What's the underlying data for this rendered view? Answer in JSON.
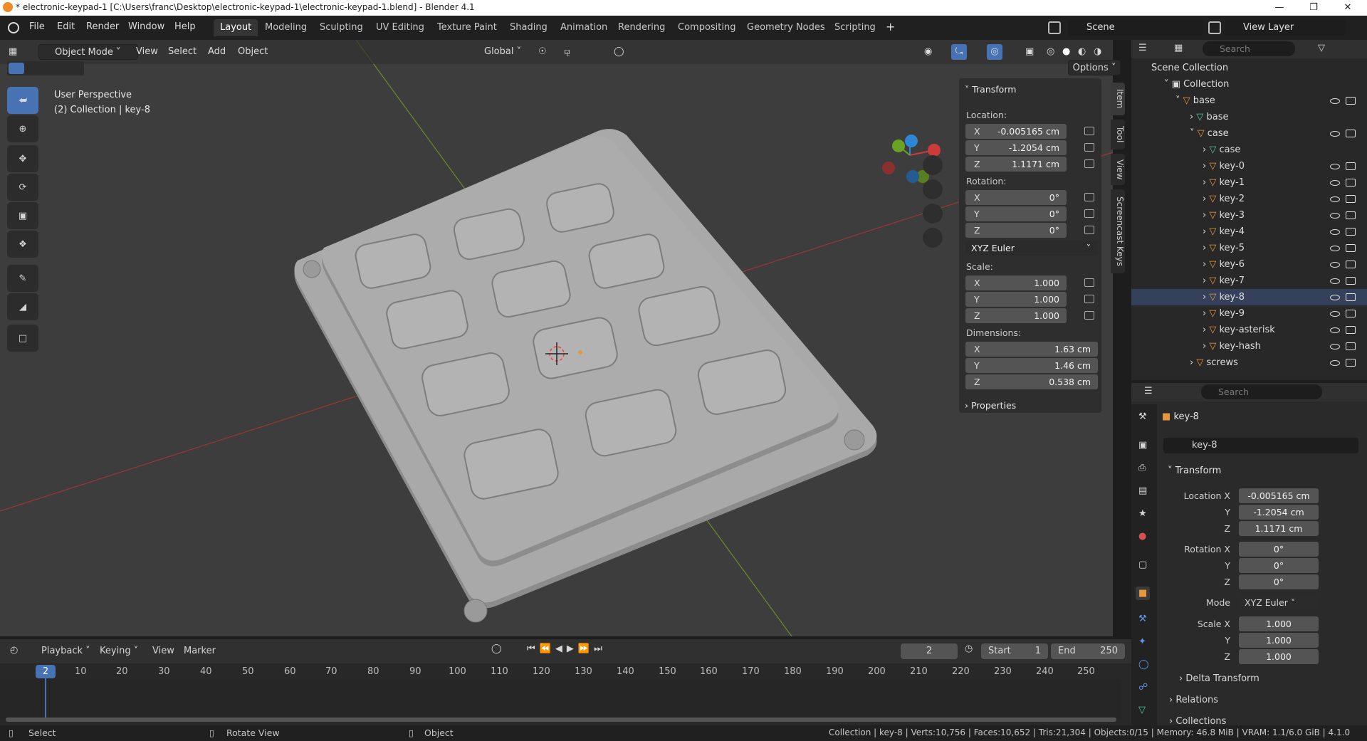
{
  "window": {
    "title": "* electronic-keypad-1 [C:\\Users\\franc\\Desktop\\electronic-keypad-1\\electronic-keypad-1.blend] - Blender 4.1"
  },
  "menu": [
    "File",
    "Edit",
    "Render",
    "Window",
    "Help"
  ],
  "workspaces": [
    "Layout",
    "Modeling",
    "Sculpting",
    "UV Editing",
    "Texture Paint",
    "Shading",
    "Animation",
    "Rendering",
    "Compositing",
    "Geometry Nodes",
    "Scripting"
  ],
  "active_workspace": "Layout",
  "scene": "Scene",
  "view_layer": "View Layer",
  "viewport_header": {
    "mode": "Object Mode",
    "menus": [
      "View",
      "Select",
      "Add",
      "Object"
    ],
    "orientation": "Global",
    "options": "Options"
  },
  "viewport_info": {
    "line1": "User Perspective",
    "line2": "(2) Collection | key-8"
  },
  "npanel": {
    "title": "Transform",
    "location_label": "Location:",
    "location": [
      {
        "axis": "X",
        "value": "-0.005165 cm"
      },
      {
        "axis": "Y",
        "value": "-1.2054 cm"
      },
      {
        "axis": "Z",
        "value": "1.1171 cm"
      }
    ],
    "rotation_label": "Rotation:",
    "rotation": [
      {
        "axis": "X",
        "value": "0°"
      },
      {
        "axis": "Y",
        "value": "0°"
      },
      {
        "axis": "Z",
        "value": "0°"
      }
    ],
    "rotation_mode": "XYZ Euler",
    "scale_label": "Scale:",
    "scale": [
      {
        "axis": "X",
        "value": "1.000"
      },
      {
        "axis": "Y",
        "value": "1.000"
      },
      {
        "axis": "Z",
        "value": "1.000"
      }
    ],
    "dimensions_label": "Dimensions:",
    "dimensions": [
      {
        "axis": "X",
        "value": "1.63 cm"
      },
      {
        "axis": "Y",
        "value": "1.46 cm"
      },
      {
        "axis": "Z",
        "value": "0.538 cm"
      }
    ],
    "properties": "Properties",
    "tabs": [
      "Item",
      "Tool",
      "View",
      "Screencast Keys"
    ]
  },
  "outliner": {
    "search_placeholder": "Search",
    "scene_collection": "Scene Collection",
    "rows": [
      {
        "label": "Collection",
        "indent": 1
      },
      {
        "label": "base",
        "indent": 2
      },
      {
        "label": "base",
        "indent": 3
      },
      {
        "label": "case",
        "indent": 3
      },
      {
        "label": "case",
        "indent": 4
      },
      {
        "label": "key-0",
        "indent": 4
      },
      {
        "label": "key-1",
        "indent": 4
      },
      {
        "label": "key-2",
        "indent": 4
      },
      {
        "label": "key-3",
        "indent": 4
      },
      {
        "label": "key-4",
        "indent": 4
      },
      {
        "label": "key-5",
        "indent": 4
      },
      {
        "label": "key-6",
        "indent": 4
      },
      {
        "label": "key-7",
        "indent": 4
      },
      {
        "label": "key-8",
        "indent": 4
      },
      {
        "label": "key-9",
        "indent": 4
      },
      {
        "label": "key-asterisk",
        "indent": 4
      },
      {
        "label": "key-hash",
        "indent": 4
      },
      {
        "label": "screws",
        "indent": 3
      }
    ],
    "selected": "key-8"
  },
  "properties": {
    "search_placeholder": "Search",
    "object_name": "key-8",
    "data_name": "key-8",
    "transform": "Transform",
    "location_x_label": "Location X",
    "location": [
      "-0.005165 cm",
      "-1.2054 cm",
      "1.1171 cm"
    ],
    "rotation_x_label": "Rotation X",
    "rotation": [
      "0°",
      "0°",
      "0°"
    ],
    "mode_label": "Mode",
    "mode": "XYZ Euler",
    "scale_x_label": "Scale X",
    "scale": [
      "1.000",
      "1.000",
      "1.000"
    ],
    "y_label": "Y",
    "z_label": "Z",
    "delta_transform": "Delta Transform",
    "relations": "Relations",
    "collections": "Collections"
  },
  "timeline": {
    "menus": [
      "Playback",
      "Keying",
      "View",
      "Marker"
    ],
    "current_frame": "2",
    "start_label": "Start",
    "start": "1",
    "end_label": "End",
    "end": "250",
    "ticks": [
      "2",
      "10",
      "20",
      "30",
      "40",
      "50",
      "60",
      "70",
      "80",
      "90",
      "100",
      "110",
      "120",
      "130",
      "140",
      "150",
      "160",
      "170",
      "180",
      "190",
      "200",
      "210",
      "220",
      "230",
      "240",
      "250"
    ]
  },
  "statusbar": {
    "select": "Select",
    "rotate": "Rotate View",
    "object": "Object",
    "stats": "Collection | key-8 | Verts:10,756 | Faces:10,652 | Tris:21,304 | Objects:0/15 | Memory: 46.8 MiB | VRAM: 1.1/6.0 GiB | 4.1.0"
  },
  "colors": {
    "accent": "#4772b3",
    "header": "#303030",
    "viewport": "#3d3d3d",
    "object_orange": "#e8983c",
    "mesh_green": "#4ec9a5"
  }
}
